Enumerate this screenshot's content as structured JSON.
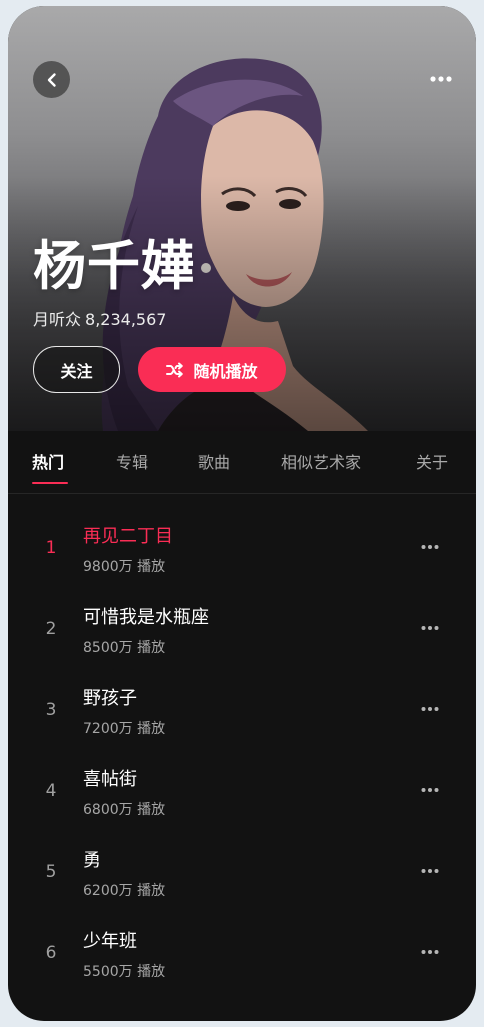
{
  "artist": {
    "name": "杨千嬅",
    "listeners_label": "月听众",
    "listeners_count": "8,234,567"
  },
  "actions": {
    "follow_label": "关注",
    "shuffle_label": "随机播放"
  },
  "tabs": [
    {
      "label": "热门",
      "active": true
    },
    {
      "label": "专辑",
      "active": false
    },
    {
      "label": "歌曲",
      "active": false
    },
    {
      "label": "相似艺术家",
      "active": false
    },
    {
      "label": "关于",
      "active": false
    }
  ],
  "songs": [
    {
      "index": "1",
      "title": "再见二丁目",
      "plays": "9800万 播放",
      "current": true
    },
    {
      "index": "2",
      "title": "可惜我是水瓶座",
      "plays": "8500万 播放",
      "current": false
    },
    {
      "index": "3",
      "title": "野孩子",
      "plays": "7200万 播放",
      "current": false
    },
    {
      "index": "4",
      "title": "喜帖街",
      "plays": "6800万 播放",
      "current": false
    },
    {
      "index": "5",
      "title": "勇",
      "plays": "6200万 播放",
      "current": false
    },
    {
      "index": "6",
      "title": "少年班",
      "plays": "5500万 播放",
      "current": false
    }
  ],
  "icons": {
    "back": "chevron-left-icon",
    "more": "more-horizontal-icon",
    "shuffle": "shuffle-icon"
  },
  "colors": {
    "accent": "#fa2d55",
    "background": "#121212",
    "text_primary": "#ffffff",
    "text_secondary": "#a6a6a6"
  }
}
